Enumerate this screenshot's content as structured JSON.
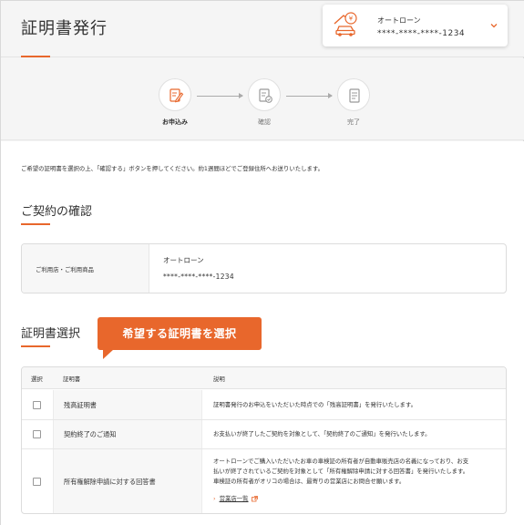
{
  "header": {
    "title": "証明書発行",
    "account": {
      "name": "オートローン",
      "number": "****-****-****-1234",
      "icon": "car-loan-icon"
    }
  },
  "stepper": {
    "steps": [
      {
        "label": "お申込み",
        "icon": "pencil-document-icon",
        "active": true
      },
      {
        "label": "確認",
        "icon": "checklist-document-icon",
        "active": false
      },
      {
        "label": "完了",
        "icon": "document-icon",
        "active": false
      }
    ]
  },
  "intro": "ご希望の証明書を選択の上、「確認する」ボタンを押してください。約1週間ほどでご登録住所へお送りいたします。",
  "contract": {
    "section_title": "ご契約の確認",
    "label": "ご利用店・ご利用商品",
    "product": "オートローン",
    "number": "****-****-****-1234"
  },
  "certificates": {
    "section_title": "証明書選択",
    "callout": "希望する証明書を選択",
    "headers": {
      "select": "選択",
      "name": "証明書",
      "description": "説明"
    },
    "rows": [
      {
        "name": "残高証明書",
        "checked": false,
        "description": [
          "証明書発行のお申込をいただいた時点での「残高証明書」を発行いたします。"
        ]
      },
      {
        "name": "契約終了のご通知",
        "checked": false,
        "description": [
          "お支払いが終了したご契約を対象として、「契約終了のご通知」を発行いたします。"
        ]
      },
      {
        "name": "所有権解除申請に対する回答書",
        "checked": false,
        "description": [
          "オートローンでご購入いただいたお車の車検証の所有者が自動車販売店の名義になっており、お支",
          "払いが終了されているご契約を対象として「所有権解除申請に対する回答書」を発行いたします。",
          "車検証の所有者がオリコの場合は、最寄りの営業店にお問合せ願います。"
        ],
        "link": "営業店一覧"
      }
    ]
  },
  "colors": {
    "accent": "#e8672c",
    "border": "#dcdcdc",
    "header_bg": "#f5f5f5"
  }
}
